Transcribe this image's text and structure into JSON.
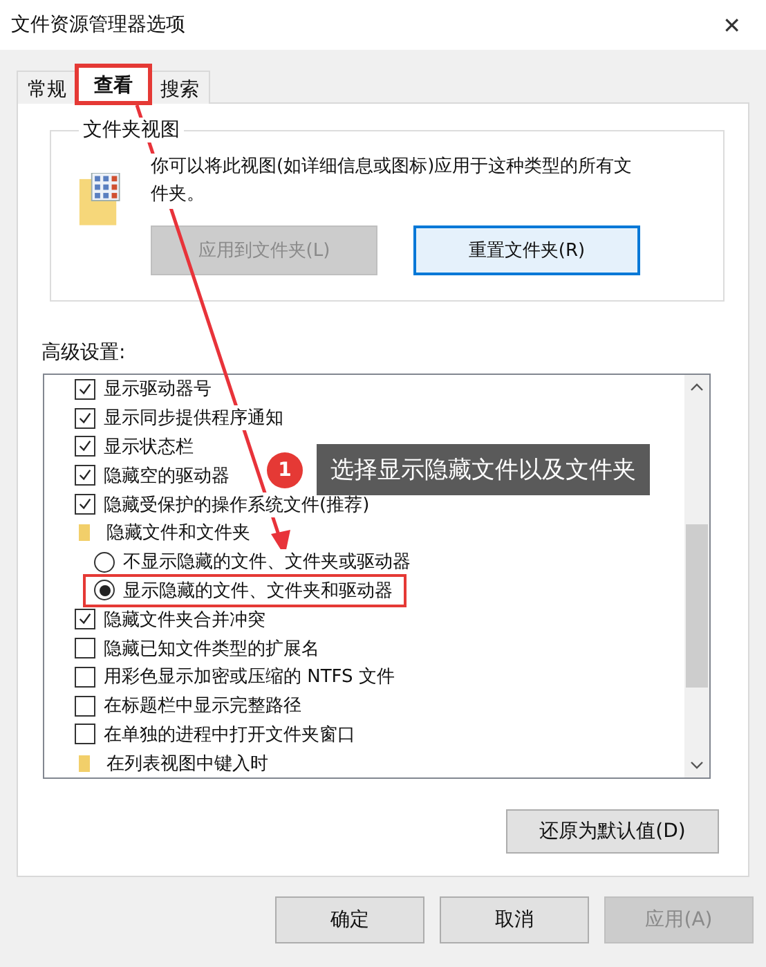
{
  "window": {
    "title": "文件资源管理器选项",
    "close": "✕"
  },
  "tabs": [
    {
      "label": "常规",
      "selected": false
    },
    {
      "label": "查看",
      "selected": true,
      "highlighted": true
    },
    {
      "label": "搜索",
      "selected": false
    }
  ],
  "folder_views": {
    "title": "文件夹视图",
    "description": "你可以将此视图(如详细信息或图标)应用于这种类型的所有文件夹。",
    "buttons": [
      {
        "label": "应用到文件夹(L)",
        "disabled": true
      },
      {
        "label": "重置文件夹(R)",
        "disabled": false
      }
    ]
  },
  "advanced": {
    "label": "高级设置:",
    "items": [
      {
        "kind": "checkbox",
        "label": "显示驱动器号",
        "checked": true
      },
      {
        "kind": "checkbox",
        "label": "显示同步提供程序通知",
        "checked": true
      },
      {
        "kind": "checkbox",
        "label": "显示状态栏",
        "checked": true
      },
      {
        "kind": "checkbox",
        "label": "隐藏空的驱动器",
        "checked": true
      },
      {
        "kind": "checkbox",
        "label": "隐藏受保护的操作系统文件(推荐)",
        "checked": true
      },
      {
        "kind": "folder",
        "label": "隐藏文件和文件夹"
      },
      {
        "kind": "radio",
        "label": "不显示隐藏的文件、文件夹或驱动器",
        "selected": false,
        "highlighted": false
      },
      {
        "kind": "radio",
        "label": "显示隐藏的文件、文件夹和驱动器",
        "selected": true,
        "highlighted": true
      },
      {
        "kind": "checkbox",
        "label": "隐藏文件夹合并冲突",
        "checked": true
      },
      {
        "kind": "checkbox",
        "label": "隐藏已知文件类型的扩展名",
        "checked": false
      },
      {
        "kind": "checkbox",
        "label": "用彩色显示加密或压缩的 NTFS 文件",
        "checked": false
      },
      {
        "kind": "checkbox",
        "label": "在标题栏中显示完整路径",
        "checked": false
      },
      {
        "kind": "checkbox",
        "label": "在单独的进程中打开文件夹窗口",
        "checked": false
      },
      {
        "kind": "folder",
        "label": "在列表视图中键入时"
      }
    ],
    "restore_button": "还原为默认值(D)"
  },
  "annotation": {
    "number": "1",
    "text": "选择显示隐藏文件以及文件夹"
  },
  "buttons": [
    {
      "label": "确定",
      "disabled": false
    },
    {
      "label": "取消",
      "disabled": false
    },
    {
      "label": "应用(A)",
      "disabled": true
    }
  ]
}
